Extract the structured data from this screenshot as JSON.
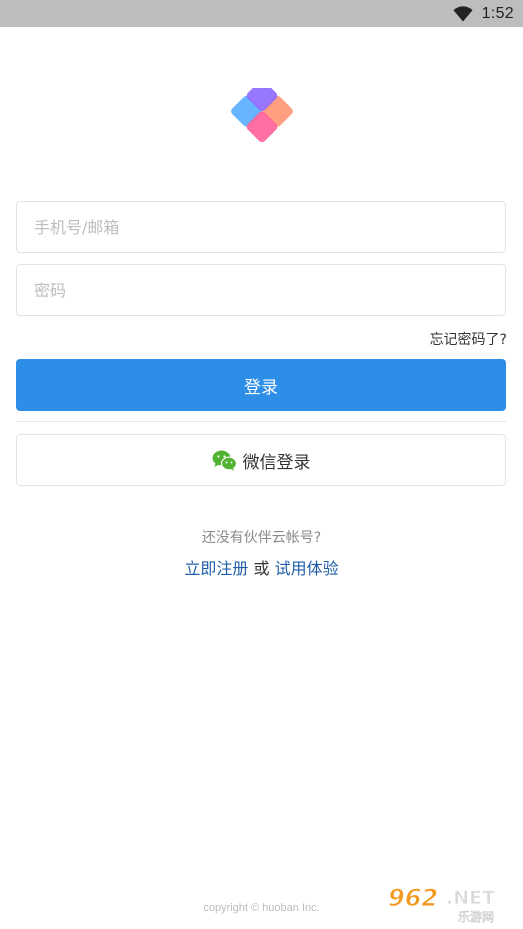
{
  "status_bar": {
    "time": "1:52",
    "wifi_icon": "wifi-icon"
  },
  "logo": {
    "icon": "app-logo"
  },
  "form": {
    "phone_placeholder": "手机号/邮箱",
    "password_placeholder": "密码",
    "forgot_label": "忘记密码了?",
    "login_label": "登录",
    "wechat_label": "微信登录",
    "wechat_icon": "wechat-icon"
  },
  "register": {
    "prompt": "还没有伙伴云帐号?",
    "register_link": "立即注册",
    "or": "或",
    "trial_link": "试用体验"
  },
  "footer": {
    "copyright": "copyright © huoban Inc."
  },
  "watermark": {
    "text": "962.NET",
    "subtext": "乐游网"
  },
  "colors": {
    "primary": "#2d8ee8",
    "link": "#1f5fa8",
    "wechat": "#51b332",
    "status_bar": "#bdbdbd"
  }
}
